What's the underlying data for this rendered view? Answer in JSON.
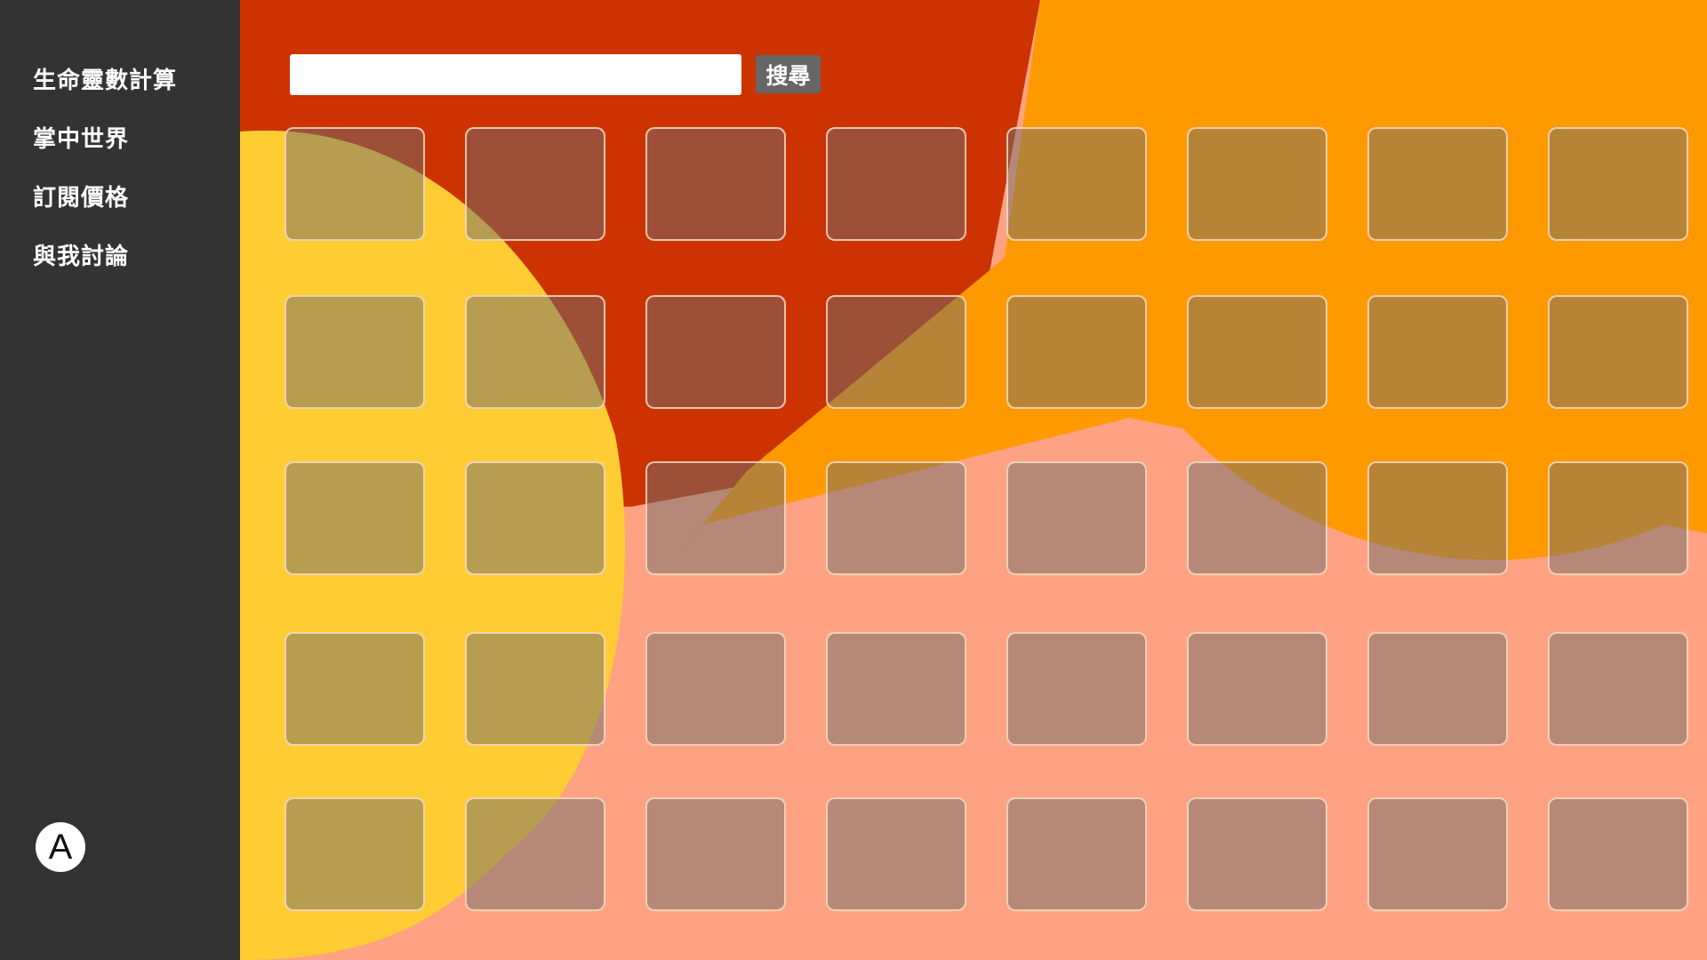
{
  "colors": {
    "sidebar_bg": "#333333",
    "base_bg": "#ffa283",
    "red_shape": "#cc3300",
    "orange_shape": "#ff9900",
    "yellow_shape": "#ffcc33",
    "search_button_bg": "#666666"
  },
  "sidebar": {
    "items": [
      {
        "label": "生命靈數計算"
      },
      {
        "label": "掌中世界"
      },
      {
        "label": "訂閱價格"
      },
      {
        "label": "與我討論"
      }
    ],
    "avatar_letter": "A"
  },
  "search": {
    "value": "",
    "placeholder": "",
    "button_label": "搜尋"
  },
  "grid": {
    "rows": 5,
    "columns": 8
  }
}
